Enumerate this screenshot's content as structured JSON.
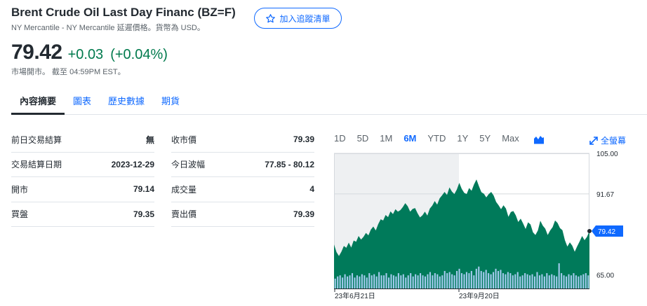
{
  "header": {
    "title": "Brent Crude Oil Last Day Financ (BZ=F)",
    "subtitle": "NY Mercantile - NY Mercantile 延遲價格。貨幣為 USD。",
    "watch_button": "加入追蹤清單"
  },
  "quote": {
    "price": "79.42",
    "change": "+0.03",
    "change_pct": "(+0.04%)",
    "status": "市場開市。 截至 04:59PM EST。"
  },
  "tabs": [
    {
      "label": "內容摘要",
      "active": true
    },
    {
      "label": "圖表",
      "active": false
    },
    {
      "label": "歷史數據",
      "active": false
    },
    {
      "label": "期貨",
      "active": false
    }
  ],
  "stats": {
    "left": [
      {
        "label": "前日交易結算",
        "value": "無"
      },
      {
        "label": "交易結算日期",
        "value": "2023-12-29"
      },
      {
        "label": "開市",
        "value": "79.14"
      },
      {
        "label": "買盤",
        "value": "79.35"
      }
    ],
    "right": [
      {
        "label": "收市價",
        "value": "79.39"
      },
      {
        "label": "今日波幅",
        "value": "77.85 - 80.12"
      },
      {
        "label": "成交量",
        "value": "4"
      },
      {
        "label": "賣出價",
        "value": "79.39"
      }
    ]
  },
  "chart_controls": {
    "ranges": [
      "1D",
      "5D",
      "1M",
      "6M",
      "YTD",
      "1Y",
      "5Y",
      "Max"
    ],
    "active_range": "6M",
    "chart_type_icon": "mountain-chart-icon",
    "fullscreen_label": "全螢幕"
  },
  "colors": {
    "accent": "#0f69ff",
    "positive": "#007a4d",
    "area_fill": "#007a5a",
    "current_price_badge": "#0f69ff"
  },
  "chart_data": {
    "type": "area",
    "y_ticks": [
      "105.00",
      "91.67",
      "65.00"
    ],
    "y_tick_values": [
      105.0,
      91.67,
      65.0
    ],
    "x_ticks": [
      "23年6月21日",
      "23年9月20日"
    ],
    "current_label": "79.42",
    "current_value": 79.42,
    "ylim": [
      60.5,
      105.0
    ],
    "grid": true,
    "values": [
      75.0,
      72.5,
      71.2,
      72.6,
      74.5,
      73.9,
      75.6,
      74.0,
      76.3,
      75.9,
      77.8,
      76.6,
      77.5,
      78.8,
      78.0,
      79.9,
      80.9,
      79.6,
      81.7,
      83.3,
      82.9,
      84.7,
      84.0,
      85.9,
      85.0,
      86.6,
      85.8,
      86.3,
      87.3,
      88.6,
      87.6,
      85.8,
      86.7,
      87.0,
      85.3,
      83.9,
      84.6,
      85.8,
      84.5,
      86.8,
      87.8,
      89.3,
      88.1,
      90.2,
      91.2,
      92.3,
      91.3,
      93.8,
      92.4,
      91.6,
      93.1,
      95.3,
      93.3,
      92.0,
      91.6,
      93.6,
      92.7,
      94.8,
      96.4,
      94.2,
      92.2,
      91.7,
      90.5,
      91.6,
      92.3,
      91.1,
      89.0,
      87.9,
      86.6,
      87.9,
      86.8,
      84.1,
      85.7,
      86.0,
      84.6,
      82.4,
      83.5,
      81.9,
      80.1,
      82.3,
      81.6,
      79.0,
      78.1,
      79.6,
      82.8,
      81.2,
      80.2,
      78.1,
      79.6,
      80.7,
      82.9,
      82.1,
      80.4,
      79.7,
      76.4,
      74.3,
      75.7,
      74.6,
      72.6,
      74.4,
      76.0,
      77.8,
      76.4,
      77.5,
      79.4
    ],
    "volume": [
      9,
      11,
      12,
      10,
      13,
      11,
      12,
      14,
      10,
      12,
      11,
      13,
      12,
      10,
      14,
      12,
      13,
      11,
      15,
      12,
      12,
      14,
      10,
      13,
      12,
      11,
      14,
      12,
      13,
      10,
      12,
      14,
      11,
      13,
      12,
      14,
      12,
      11,
      13,
      15,
      12,
      14,
      13,
      11,
      12,
      16,
      14,
      15,
      13,
      12,
      16,
      18,
      14,
      13,
      15,
      14,
      16,
      12,
      18,
      20,
      16,
      15,
      17,
      14,
      13,
      15,
      18,
      16,
      17,
      14,
      13,
      15,
      14,
      12,
      13,
      15,
      11,
      12,
      14,
      13,
      12,
      13,
      11,
      15,
      12,
      13,
      11,
      14,
      12,
      13,
      12,
      11,
      23,
      14,
      12,
      11,
      13,
      12,
      14,
      12,
      11,
      12,
      13,
      14,
      12
    ]
  }
}
